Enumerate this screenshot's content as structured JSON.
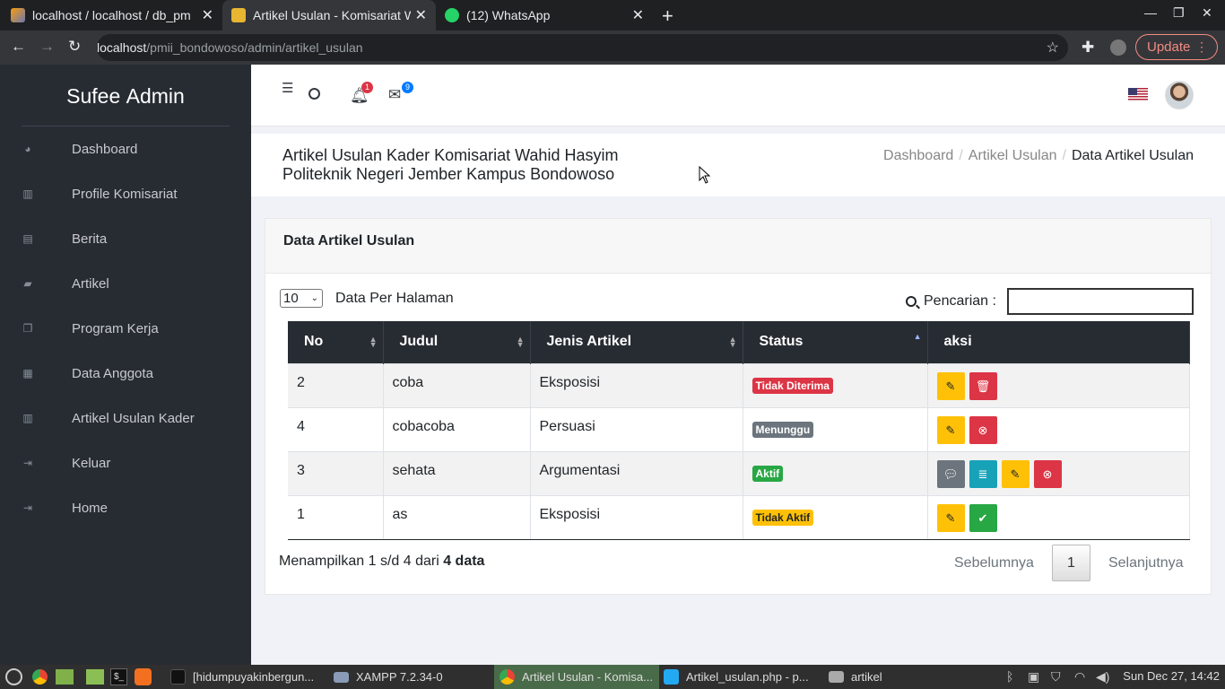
{
  "browser": {
    "tabs": [
      {
        "title": "localhost / localhost / db_pm",
        "active": false
      },
      {
        "title": "Artikel Usulan - Komisariat W",
        "active": true
      },
      {
        "title": "(12) WhatsApp",
        "active": false
      }
    ],
    "url_host": "localhost",
    "url_path": "/pmii_bondowoso/admin/artikel_usulan",
    "update_label": "Update",
    "whatsapp_count": "12"
  },
  "sidebar": {
    "brand_light": "Sufee",
    "brand_bold": "Admin",
    "items": [
      {
        "label": "Dashboard",
        "icon": "dashboard-icon"
      },
      {
        "label": "Profile Komisariat",
        "icon": "building-icon"
      },
      {
        "label": "Berita",
        "icon": "newspaper-icon"
      },
      {
        "label": "Artikel",
        "icon": "book-icon"
      },
      {
        "label": "Program Kerja",
        "icon": "files-icon"
      },
      {
        "label": "Data Anggota",
        "icon": "table-icon"
      },
      {
        "label": "Artikel Usulan Kader",
        "icon": "building-icon"
      },
      {
        "label": "Keluar",
        "icon": "sign-out-icon"
      },
      {
        "label": "Home",
        "icon": "sign-out-icon"
      }
    ]
  },
  "topbar": {
    "notif_count": "1",
    "mail_count": "9"
  },
  "header": {
    "title_line1": "Artikel Usulan Kader Komisariat Wahid Hasyim",
    "title_line2": "Politeknik Negeri Jember Kampus Bondowoso",
    "breadcrumbs": [
      "Dashboard",
      "Artikel Usulan",
      "Data Artikel Usulan"
    ]
  },
  "card": {
    "title": "Data Artikel Usulan",
    "per_page_value": "10",
    "per_page_label": "Data Per Halaman",
    "search_label": "Pencarian :",
    "search_value": "",
    "columns": [
      "No",
      "Judul",
      "Jenis Artikel",
      "Status",
      "aksi"
    ],
    "rows": [
      {
        "no": "2",
        "judul": "coba",
        "jenis": "Eksposisi",
        "status": "Tidak Diterima",
        "status_color": "#dc3545",
        "actions": [
          "edit",
          "delete"
        ]
      },
      {
        "no": "4",
        "judul": "cobacoba",
        "jenis": "Persuasi",
        "status": "Menunggu",
        "status_color": "#6c757d",
        "actions": [
          "edit",
          "reject"
        ]
      },
      {
        "no": "3",
        "judul": "sehata",
        "jenis": "Argumentasi",
        "status": "Aktif",
        "status_color": "#28a745",
        "actions": [
          "comment",
          "detail",
          "edit",
          "reject"
        ]
      },
      {
        "no": "1",
        "judul": "as",
        "jenis": "Eksposisi",
        "status": "Tidak Aktif",
        "status_color": "#ffc107",
        "actions": [
          "edit",
          "approve"
        ]
      }
    ],
    "info_prefix": "Menampilkan 1 s/d 4 dari ",
    "info_bold": "4 data",
    "prev_label": "Sebelumnya",
    "page": "1",
    "next_label": "Selanjutnya"
  },
  "taskbar": {
    "apps": [
      {
        "label": "[hidumpuyakinbergun...",
        "active": false
      },
      {
        "label": "XAMPP 7.2.34-0",
        "active": false
      },
      {
        "label": "Artikel Usulan - Komisa...",
        "active": true
      },
      {
        "label": "Artikel_usulan.php - p...",
        "active": false
      },
      {
        "label": "artikel",
        "active": false
      }
    ],
    "clock": "Sun Dec 27, 14:42"
  }
}
